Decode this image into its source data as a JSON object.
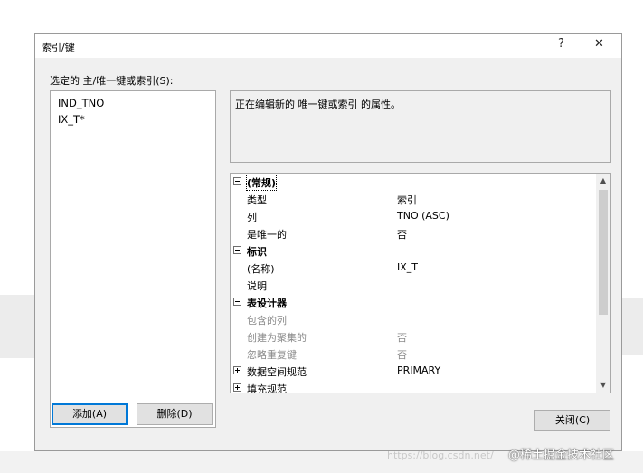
{
  "dialog": {
    "title": "索引/键",
    "help_label": "?",
    "close_label": "✕"
  },
  "selected_label": "选定的 主/唯一键或索引(S):",
  "list_items": [
    "IND_TNO",
    "IX_T*"
  ],
  "description": "正在编辑新的 唯一键或索引 的属性。",
  "property_rows": [
    {
      "kind": "category",
      "expander": "minus",
      "name": "(常规)"
    },
    {
      "kind": "property",
      "name": "类型",
      "value": "索引"
    },
    {
      "kind": "property",
      "name": "列",
      "value": "TNO (ASC)"
    },
    {
      "kind": "property",
      "name": "是唯一的",
      "value": "否"
    },
    {
      "kind": "category",
      "expander": "minus",
      "name": "标识"
    },
    {
      "kind": "property",
      "name": "(名称)",
      "value": "IX_T"
    },
    {
      "kind": "property",
      "name": "说明",
      "value": ""
    },
    {
      "kind": "category",
      "expander": "minus",
      "name": "表设计器"
    },
    {
      "kind": "property",
      "name": "包含的列",
      "value": "",
      "disabled": true
    },
    {
      "kind": "property",
      "name": "创建为聚集的",
      "value": "否",
      "disabled": true
    },
    {
      "kind": "property",
      "name": "忽略重复键",
      "value": "否",
      "disabled": true
    },
    {
      "kind": "expandable",
      "expander": "plus",
      "name": "数据空间规范",
      "value": "PRIMARY"
    },
    {
      "kind": "expandable",
      "expander": "plus",
      "name": "填充规范",
      "value": ""
    }
  ],
  "buttons": {
    "add": "添加(A)",
    "delete": "删除(D)",
    "close": "关闭(C)"
  },
  "watermark": {
    "text": "@稀土掘金技术社区",
    "url": "https://blog.csdn.net/"
  },
  "colors": {
    "dialog_bg": "#f0f0f0",
    "accent": "#0078d7"
  }
}
